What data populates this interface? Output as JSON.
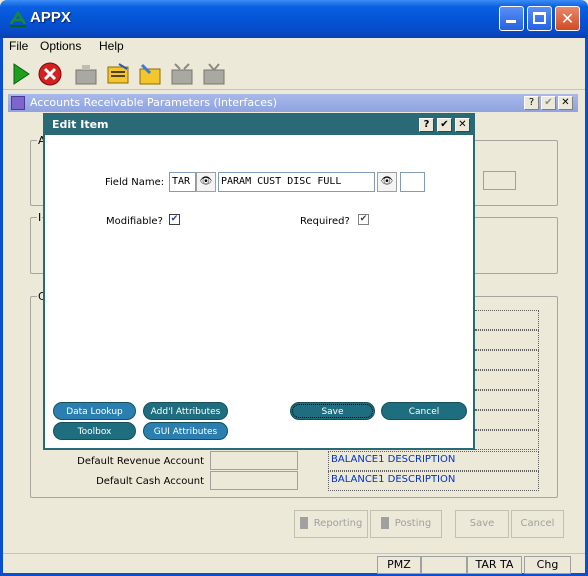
{
  "window": {
    "title": "APPX",
    "min": "_",
    "max": "□",
    "close": "✕"
  },
  "menu": [
    "File",
    "Options",
    "Help"
  ],
  "toolbar": [
    "run-icon",
    "stop-icon",
    "folder-icon",
    "edit-icon",
    "open-icon",
    "folder2-icon",
    "tv-icon"
  ],
  "inner": {
    "title": "Accounts Receivable Parameters (Interfaces)",
    "help": "?",
    "ok": "✔",
    "close": "✕",
    "group1_label": "A",
    "group2_label": "I",
    "group3_label": "C",
    "row_revenue_label": "Default Revenue Account",
    "row_cash_label": "Default Cash Account",
    "row_revenue_value": "BALANCE1 DESCRIPTION",
    "row_cash_value": "BALANCE1 DESCRIPTION",
    "buttons": [
      "Reporting",
      "Posting",
      "Save",
      "Cancel"
    ]
  },
  "status": [
    "PMZ",
    "TAR TA",
    "Chg"
  ],
  "dialog": {
    "title": "Edit Item",
    "help": "?",
    "ok": "✔",
    "close": "✕",
    "field_name_label": "Field Name:",
    "field_prefix": "TAR",
    "field_value": "PARAM CUST DISC FULL",
    "modifiable_label": "Modifiable?",
    "required_label": "Required?",
    "modifiable_checked": true,
    "required_checked": true,
    "btn_data_lookup": "Data Lookup",
    "btn_addl_attributes": "Add'l Attributes",
    "btn_toolbox": "Toolbox",
    "btn_gui_attributes": "GUI Attributes",
    "btn_save": "Save",
    "btn_cancel": "Cancel"
  },
  "colors": {
    "dialog_title": "#2a6a76",
    "pill": "#1f6e80",
    "xp_blue": "#0454d4"
  }
}
